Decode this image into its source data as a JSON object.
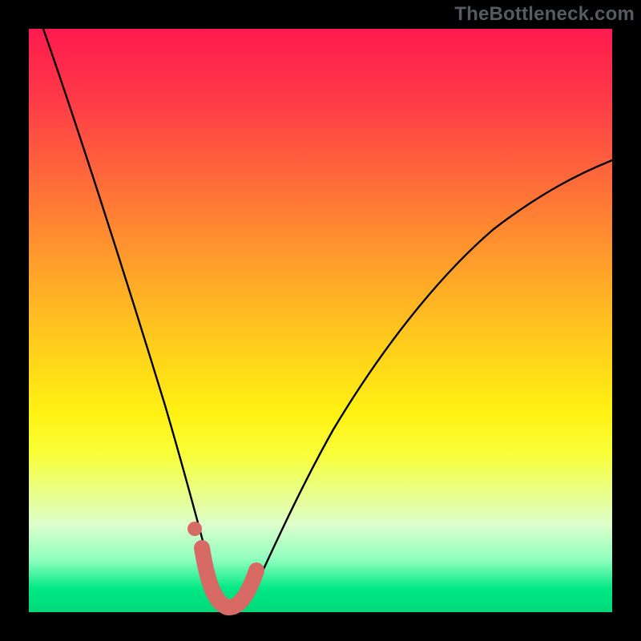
{
  "watermark": "TheBottleneck.com",
  "chart_data": {
    "type": "line",
    "title": "",
    "xlabel": "",
    "ylabel": "",
    "xlim": [
      0,
      10
    ],
    "ylim": [
      0,
      100
    ],
    "grid": false,
    "legend": false,
    "series": [
      {
        "name": "bottleneck-curve",
        "x": [
          0.0,
          0.5,
          1.0,
          1.5,
          2.0,
          2.4,
          2.7,
          2.9,
          3.1,
          3.3,
          3.5,
          3.7,
          4.0,
          4.5,
          5.0,
          5.5,
          6.0,
          6.5,
          7.0,
          7.5,
          8.0,
          8.5,
          9.0,
          9.5,
          10.0
        ],
        "values": [
          100,
          88,
          73,
          57,
          40,
          26,
          15,
          8,
          3,
          0,
          0,
          2,
          8,
          20,
          33,
          43,
          52,
          59,
          65,
          69,
          72,
          74,
          76,
          77,
          78
        ]
      },
      {
        "name": "optimal-segment",
        "x": [
          2.9,
          3.1,
          3.3,
          3.5,
          3.7
        ],
        "values": [
          8,
          3,
          0,
          0,
          2
        ]
      },
      {
        "name": "optimal-marker",
        "x": [
          2.75
        ],
        "values": [
          12
        ]
      }
    ],
    "annotations": []
  }
}
